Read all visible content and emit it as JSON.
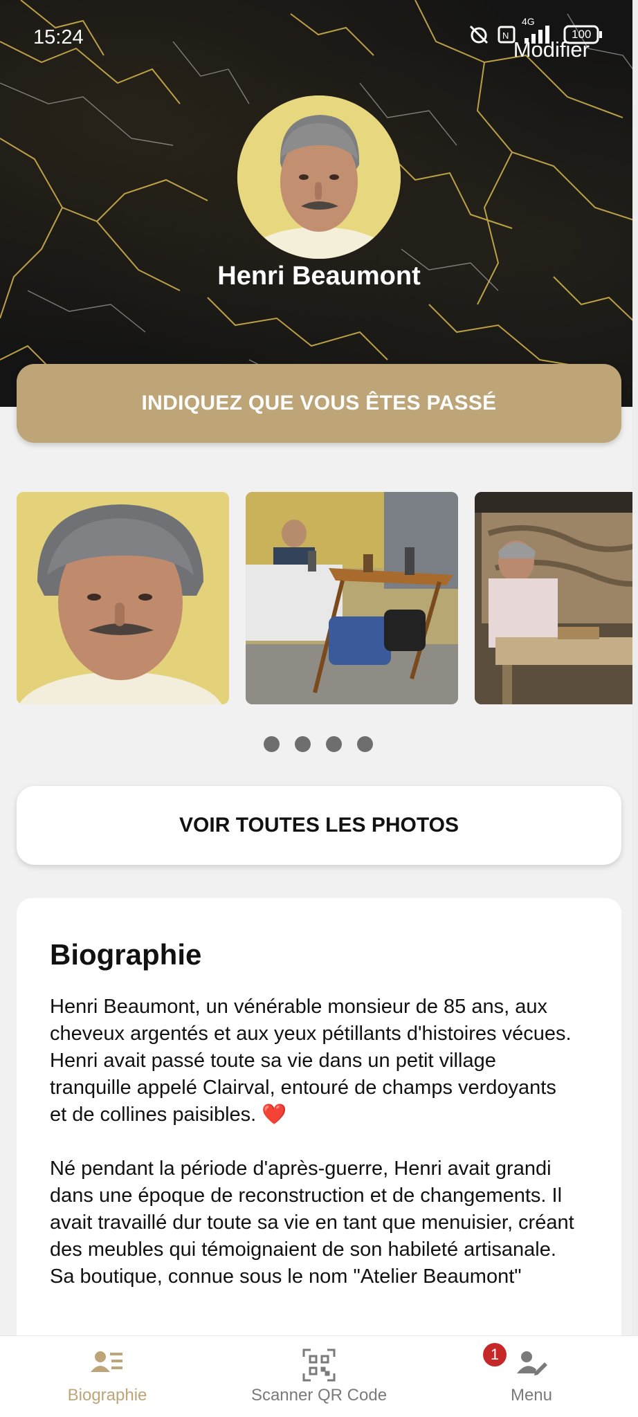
{
  "status_bar": {
    "time": "15:24",
    "network": "4G",
    "battery": "100"
  },
  "header": {
    "action_label": "Modifier",
    "person_name": "Henri Beaumont"
  },
  "cta": {
    "label": "INDIQUEZ QUE VOUS ÊTES PASSÉ"
  },
  "gallery": {
    "photos": [
      "portrait",
      "market-stall",
      "woodworking"
    ],
    "dots_count": 4,
    "view_all_label": "VOIR TOUTES LES PHOTOS"
  },
  "biography": {
    "title": "Biographie",
    "paragraph_1": "Henri Beaumont, un vénérable monsieur de 85 ans, aux cheveux argentés et aux yeux pétillants d'histoires vécues. Henri avait passé toute sa vie dans un petit village tranquille appelé Clairval, entouré de champs verdoyants et de collines paisibles.",
    "paragraph_1_emoji": "❤️",
    "paragraph_2": "Né pendant la période d'après-guerre, Henri avait grandi dans une époque de reconstruction et de changements. Il avait travaillé dur toute sa vie en tant que menuisier, créant des meubles qui témoignaient de son habileté artisanale. Sa boutique, connue sous le nom \"Atelier Beaumont\""
  },
  "bottom_nav": {
    "items": [
      {
        "label": "Biographie",
        "icon": "biography-icon",
        "active": true
      },
      {
        "label": "Scanner QR Code",
        "icon": "qr-code-icon",
        "active": false
      },
      {
        "label": "Menu",
        "icon": "user-edit-icon",
        "active": false,
        "badge": "1"
      }
    ]
  },
  "colors": {
    "accent": "#bea577",
    "background": "#f1f1f1",
    "badge": "#c62828"
  }
}
